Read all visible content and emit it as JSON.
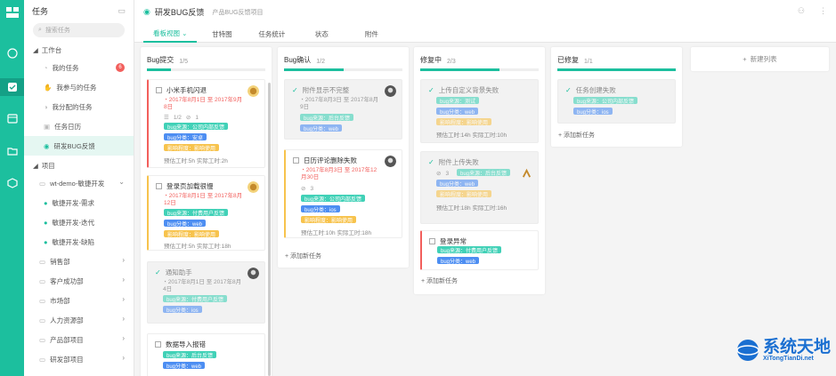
{
  "sidebar": {
    "title": "任务",
    "search_placeholder": "搜索任务",
    "workbench": "工作台",
    "items": [
      {
        "label": "我的任务",
        "badge": "6"
      },
      {
        "label": "我参与的任务"
      },
      {
        "label": "我分配的任务"
      },
      {
        "label": "任务日历"
      },
      {
        "label": "研发BUG反馈"
      }
    ],
    "projects_label": "项目",
    "projects": [
      {
        "label": "wt-demo-敏捷开发"
      },
      {
        "label": "敏捷开发-需求"
      },
      {
        "label": "敏捷开发-迭代"
      },
      {
        "label": "敏捷开发-缺陷"
      },
      {
        "label": "销售部"
      },
      {
        "label": "客户成功部"
      },
      {
        "label": "市场部"
      },
      {
        "label": "人力资源部"
      },
      {
        "label": "产品部项目"
      },
      {
        "label": "研发部项目"
      }
    ]
  },
  "header": {
    "title": "研发BUG反馈",
    "subtitle": "产品BUG反馈项目",
    "tabs": [
      "看板视图",
      "甘特图",
      "任务统计",
      "状态",
      "附件"
    ]
  },
  "columns": [
    {
      "name": "Bug提交",
      "count": "1/5",
      "progress": 0.2
    },
    {
      "name": "Bug确认",
      "count": "1/2",
      "progress": 0.5
    },
    {
      "name": "修复中",
      "count": "2/3",
      "progress": 0.67
    },
    {
      "name": "已修复",
      "count": "1/1",
      "progress": 1.0
    }
  ],
  "cards": {
    "c1": {
      "title": "小米手机闪退",
      "date": "2017年8月1日 至 2017年9月8日",
      "meta_count": "1/2",
      "meta_att": "1",
      "tag1": "bug来源：公司内部反馈",
      "tag2": "bug分类：安卓",
      "tag3": "影响程度：影响使用",
      "est": "预估工时:5h  实际工时:2h"
    },
    "c2": {
      "title": "登录页加载很慢",
      "date": "2017年8月1日 至 2017年8月12日",
      "tag1": "bug来源：付费用户反馈",
      "tag2": "bug分类：web",
      "tag3": "影响程度：影响使用",
      "est": "预估工时:5h  实际工时:18h"
    },
    "c3": {
      "title": "通知助手",
      "date": "2017年8月1日 至 2017年8月4日",
      "tag1": "bug来源：付费用户反馈",
      "tag2": "bug分类：ios"
    },
    "c4": {
      "title": "数据导入报错",
      "tag1": "bug来源：后台反馈",
      "tag2": "bug分类：web"
    },
    "c5": {
      "title": "附件显示不完整",
      "date": "2017年8月3日 至 2017年8月9日",
      "tag1": "bug来源：后台反馈",
      "tag2": "bug分类：web"
    },
    "c6": {
      "title": "日历评论删除失败",
      "date": "2017年8月3日 至 2017年12月30日",
      "meta_att": "3",
      "tag1": "bug来源：公司内部反馈",
      "tag2": "bug分类：ios",
      "tag3": "影响程度：影响使用",
      "est": "预估工时:10h  实际工时:18h"
    },
    "c7": {
      "title": "上传自定义背景失败",
      "tag1": "bug来源：测试",
      "tag2": "bug分类：web",
      "tag3": "影响程度：影响使用",
      "est": "预估工时:14h  实际工时:10h"
    },
    "c8": {
      "title": "附件上传失败",
      "meta_att": "3",
      "tag1": "bug来源：后台反馈",
      "tag2": "bug分类：web",
      "tag3": "影响程度：影响使用",
      "est": "预估工时:18h  实际工时:16h"
    },
    "c9": {
      "title": "登录异常",
      "tag1": "bug来源：付费用户反馈",
      "tag2": "bug分类：web"
    },
    "c10": {
      "title": "任务创建失败",
      "tag1": "bug来源：公司内部反馈",
      "tag2": "bug分类：ios"
    }
  },
  "add_task": "添加新任务",
  "new_list": "新建列表",
  "watermark": {
    "title": "系统天地",
    "url": "XiTongTianDi.net"
  }
}
